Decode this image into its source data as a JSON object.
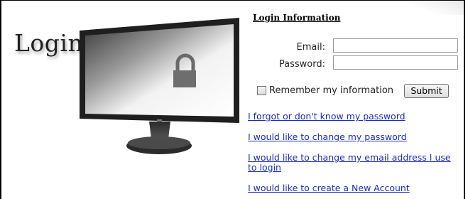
{
  "page": {
    "heading": "Login"
  },
  "form": {
    "section_title": "Login Information",
    "email_label": "Email:",
    "email_value": "",
    "password_label": "Password:",
    "password_value": "",
    "remember_label": "Remember my information",
    "remember_checked": false,
    "submit_label": "Submit"
  },
  "links": [
    "I forgot or don't know my password",
    "I would like to change my password",
    "I would like to change my email address I use to login",
    "I would like to create a New Account"
  ],
  "icons": {
    "lock": "padlock-icon"
  },
  "colors": {
    "link": "#1a2dbb",
    "text": "#222222"
  }
}
